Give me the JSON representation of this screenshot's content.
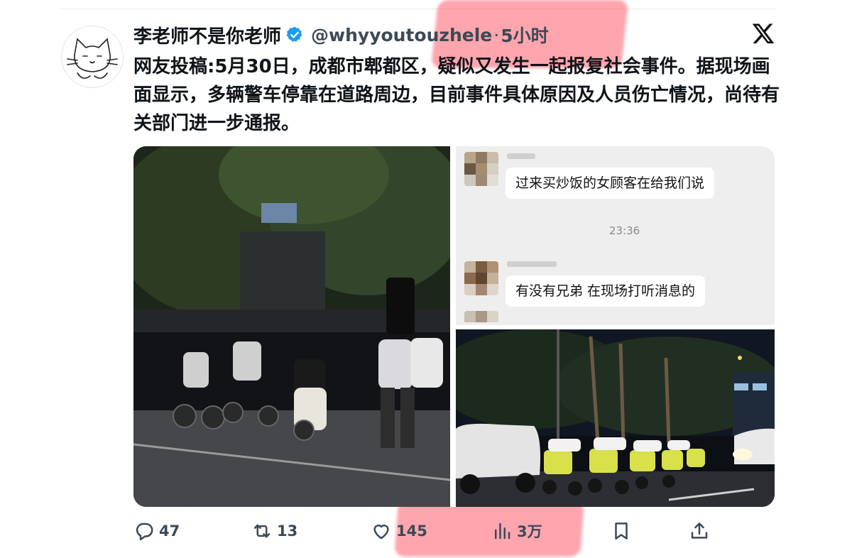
{
  "tweet": {
    "display_name": "李老师不是你老师",
    "handle": "@whyyoutouzhele",
    "separator": "·",
    "time": "5小时",
    "text": "网友投稿:5月30日，成都市郫都区，疑似又发生一起报复社会事件。据现场画面显示，多辆警车停靠在道路周边，目前事件具体原因及人员伤亡情况，尚待有关部门进一步通报。"
  },
  "media": {
    "chat": {
      "message_1": "过来买炒饭的女顾客在给我们说",
      "timestamp": "23:36",
      "message_2": "有没有兄弟 在现场打听消息的"
    }
  },
  "actions": {
    "replies": "47",
    "retweets": "13",
    "likes": "145",
    "views": "3万"
  },
  "colors": {
    "verified_badge": "#1d9bf0",
    "highlight": "#ff5c6c",
    "text_primary": "#0f1419",
    "text_secondary": "#3c4a56"
  }
}
